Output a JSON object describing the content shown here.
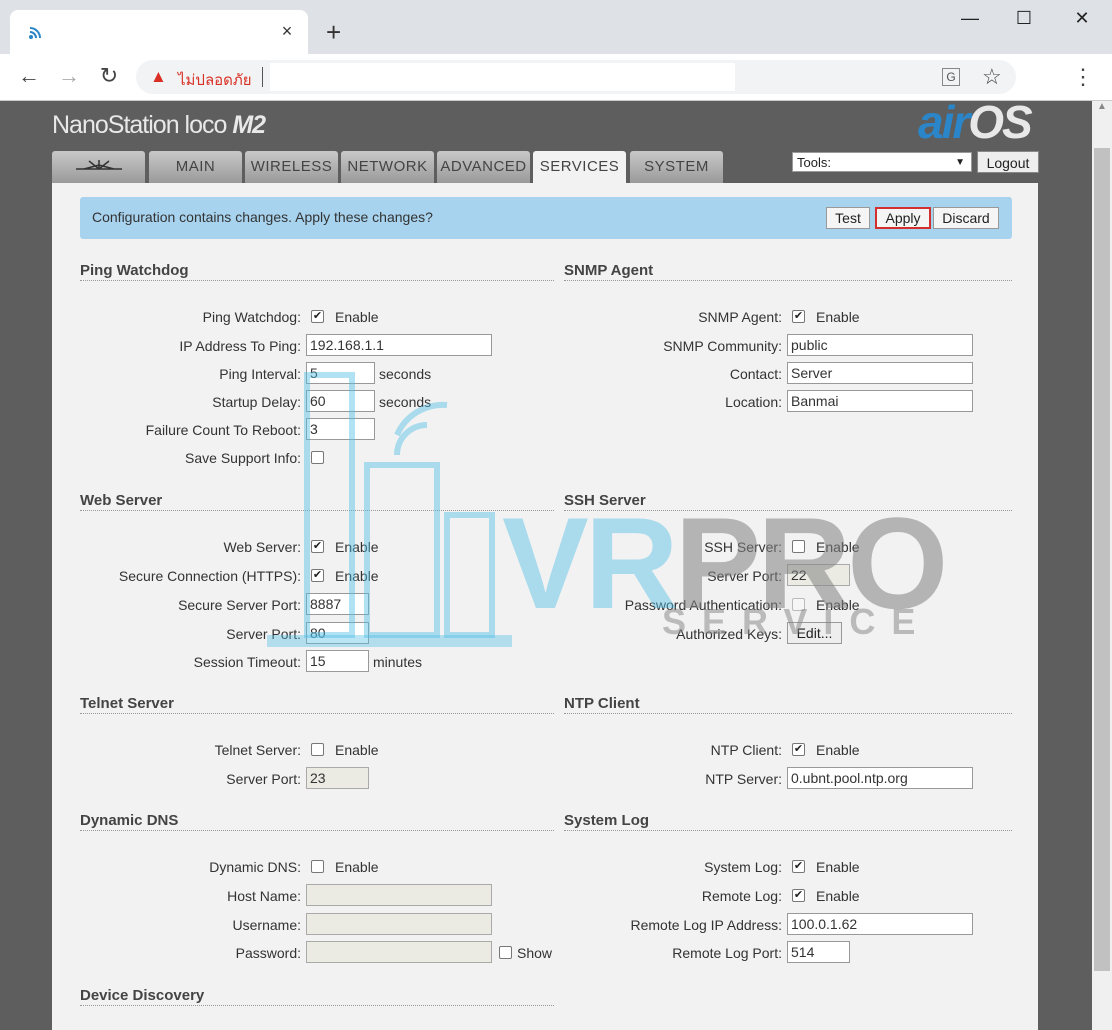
{
  "browser": {
    "tab_close": "×",
    "new_tab": "+",
    "win_min": "—",
    "win_max": "☐",
    "win_close": "✕",
    "back": "←",
    "forward": "→",
    "reload": "↻",
    "insecure_label": "ไม่ปลอดภัย",
    "url_value": "",
    "menu": "⋮"
  },
  "header": {
    "brand": "NanoStation loco",
    "brand_model": "M2",
    "logo_air": "air",
    "logo_os": "OS"
  },
  "tabs": [
    "",
    "MAIN",
    "WIRELESS",
    "NETWORK",
    "ADVANCED",
    "SERVICES",
    "SYSTEM"
  ],
  "tools": {
    "label": "Tools:",
    "logout": "Logout"
  },
  "notice": {
    "message": "Configuration contains changes. Apply these changes?",
    "test": "Test",
    "apply": "Apply",
    "discard": "Discard"
  },
  "ping": {
    "title": "Ping Watchdog",
    "l_watchdog": "Ping Watchdog:",
    "enable": "Enable",
    "l_ip": "IP Address To Ping:",
    "ip": "192.168.1.1",
    "l_interval": "Ping Interval:",
    "interval": "5",
    "seconds": "seconds",
    "l_delay": "Startup Delay:",
    "delay": "60",
    "l_failure": "Failure Count To Reboot:",
    "failure": "3",
    "l_support": "Save Support Info:"
  },
  "snmp": {
    "title": "SNMP Agent",
    "l_agent": "SNMP Agent:",
    "enable": "Enable",
    "l_community": "SNMP Community:",
    "community": "public",
    "l_contact": "Contact:",
    "contact": "Server",
    "l_location": "Location:",
    "location": "Banmai"
  },
  "web": {
    "title": "Web Server",
    "l_web": "Web Server:",
    "enable": "Enable",
    "l_https": "Secure Connection (HTTPS):",
    "l_sport": "Secure Server Port:",
    "sport": "8887",
    "l_port": "Server Port:",
    "port": "80",
    "l_timeout": "Session Timeout:",
    "timeout": "15",
    "minutes": "minutes"
  },
  "ssh": {
    "title": "SSH Server",
    "l_ssh": "SSH Server:",
    "enable": "Enable",
    "l_port": "Server Port:",
    "port": "22",
    "l_pass": "Password Authentication:",
    "l_keys": "Authorized Keys:",
    "edit": "Edit..."
  },
  "telnet": {
    "title": "Telnet Server",
    "l_telnet": "Telnet Server:",
    "enable": "Enable",
    "l_port": "Server Port:",
    "port": "23"
  },
  "ntp": {
    "title": "NTP Client",
    "l_client": "NTP Client:",
    "enable": "Enable",
    "l_server": "NTP Server:",
    "server": "0.ubnt.pool.ntp.org"
  },
  "ddns": {
    "title": "Dynamic DNS",
    "l_ddns": "Dynamic DNS:",
    "enable": "Enable",
    "l_host": "Host Name:",
    "host": "",
    "l_user": "Username:",
    "user": "",
    "l_pass": "Password:",
    "pass": "",
    "show": "Show"
  },
  "syslog": {
    "title": "System Log",
    "l_syslog": "System Log:",
    "enable": "Enable",
    "l_remote": "Remote Log:",
    "l_ip": "Remote Log IP Address:",
    "ip": "100.0.1.62",
    "l_port": "Remote Log Port:",
    "port": "514"
  },
  "discovery": {
    "title": "Device Discovery"
  },
  "watermark": {
    "vr": "VR",
    "pro": "PRO",
    "service": "SERVICE"
  },
  "colors": {
    "notice_bg": "#a8d3ef",
    "apply_highlight": "#d32f2f",
    "logo_blue": "#2a86c8"
  }
}
